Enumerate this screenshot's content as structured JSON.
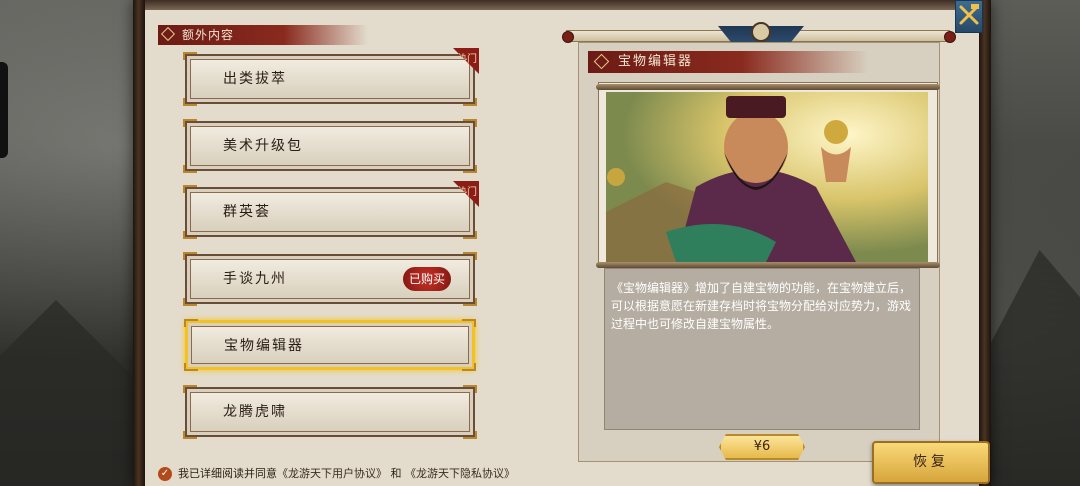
{
  "section": {
    "title": "额外内容"
  },
  "items": [
    {
      "label": "出类拔萃",
      "tag": "热门",
      "bought": ""
    },
    {
      "label": "美术升级包",
      "tag": "",
      "bought": ""
    },
    {
      "label": "群英荟",
      "tag": "热门",
      "bought": ""
    },
    {
      "label": "手谈九州",
      "tag": "",
      "bought": "已购买"
    },
    {
      "label": "宝物编辑器",
      "tag": "",
      "bought": "",
      "selected": true
    },
    {
      "label": "龙腾虎啸",
      "tag": "",
      "bought": ""
    }
  ],
  "detail": {
    "title": "宝物编辑器",
    "description": "《宝物编辑器》增加了自建宝物的功能，在宝物建立后，可以根据意愿在新建存档时将宝物分配给对应势力，游戏过程中也可修改自建宝物属性。",
    "price": "¥6"
  },
  "buttons": {
    "restore": "恢复"
  },
  "agreement": {
    "prefix": "我已详细阅读并同意",
    "user_agreement": "《龙游天下用户协议》",
    "and": "和",
    "privacy_agreement": "《龙游天下隐私协议》"
  },
  "icons": {
    "close": "tools-close-icon",
    "check": "check-icon"
  },
  "colors": {
    "accent_red": "#8a2a1e",
    "gold": "#f3c21e",
    "close_blue": "#2c5478"
  }
}
